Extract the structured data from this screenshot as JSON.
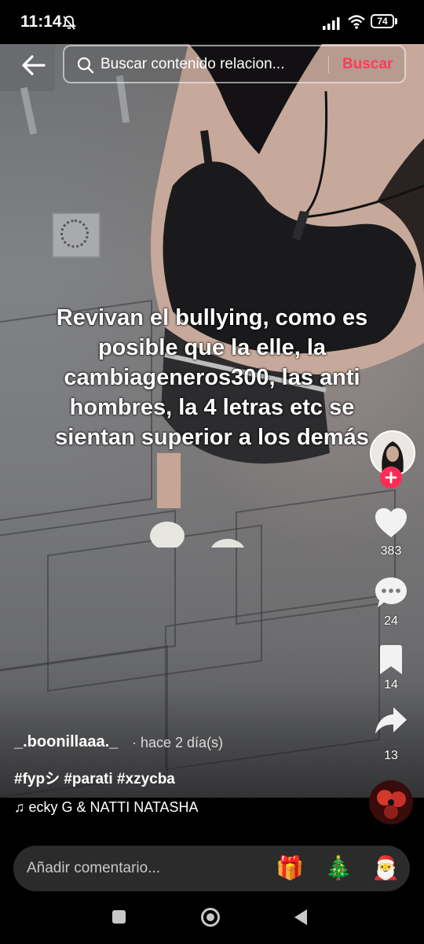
{
  "status_bar": {
    "time": "11:14",
    "battery": "74"
  },
  "search": {
    "placeholder": "Buscar contenido relacion...",
    "button_label": "Buscar"
  },
  "video": {
    "caption": "Revivan el bullying, como es posible que la elle, la cambiageneros300, las anti hombres, la 4 letras etc se sientan superior a los demás"
  },
  "actions": {
    "likes": "383",
    "comments": "24",
    "saves": "14",
    "shares": "13"
  },
  "post": {
    "username": "_.boonillaaa._",
    "time_ago": "· hace 2 día(s)",
    "hashtags": "#fypシ #parati #xzycba",
    "music": "ecky G & NATTI NATASHA"
  },
  "comment_bar": {
    "placeholder": "Añadir comentario...",
    "emojis": [
      "🎁",
      "🎄",
      "🎅"
    ]
  },
  "colors": {
    "accent": "#fe2c55",
    "search_button": "#ff3b5c"
  }
}
